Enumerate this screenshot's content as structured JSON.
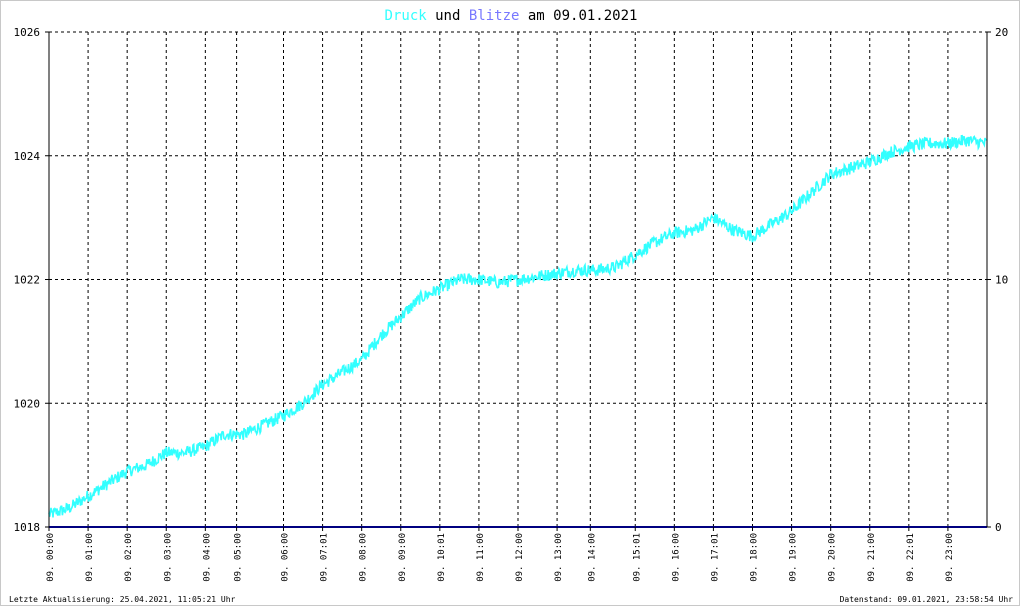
{
  "title": {
    "part1": "Druck",
    "part2": " und ",
    "part3": "Blitze",
    "part4": " am 09.01.2021",
    "colors": {
      "druck": "#33ffff",
      "blitze": "#7777ff",
      "text": "#000000"
    }
  },
  "footer": {
    "left": "Letzte Aktualisierung: 25.04.2021, 11:05:21 Uhr",
    "right": "Datenstand: 09.01.2021, 23:58:54 Uhr"
  },
  "chart_data": {
    "type": "line",
    "title": "Druck und Blitze am 09.01.2021",
    "y_left": {
      "range": [
        1018,
        1026
      ],
      "ticks": [
        "1018",
        "1020",
        "1022",
        "1024",
        "1026"
      ]
    },
    "y_right": {
      "range": [
        0,
        20
      ],
      "ticks": [
        "0",
        "10",
        "20"
      ]
    },
    "x": {
      "range_hours": [
        0,
        24
      ],
      "tick_labels": [
        "09. 00:00",
        "09. 01:00",
        "09. 02:00",
        "09. 03:00",
        "09. 04:00",
        "09. 05:00",
        "09. 06:00",
        "09. 07:01",
        "09. 08:00",
        "09. 09:00",
        "09. 10:01",
        "09. 11:00",
        "09. 12:00",
        "09. 13:00",
        "09. 14:00",
        "09. 15:01",
        "09. 16:00",
        "09. 17:01",
        "09. 18:00",
        "09. 19:00",
        "09. 20:00",
        "09. 21:00",
        "09. 22:01",
        "09. 23:00"
      ],
      "tick_hours": [
        0.0,
        1.0,
        2.0,
        3.0,
        4.0,
        4.8,
        6.0,
        7.0,
        8.0,
        9.0,
        10.0,
        11.0,
        12.0,
        13.0,
        13.85,
        15.0,
        16.0,
        17.0,
        18.0,
        19.0,
        20.0,
        21.0,
        22.0,
        23.0
      ]
    },
    "grid": true,
    "series": [
      {
        "name": "Druck",
        "color": "#33ffff",
        "axis": "left",
        "x_hours": [
          0,
          0.5,
          1,
          1.5,
          2,
          2.5,
          3,
          3.5,
          4,
          4.5,
          5,
          5.5,
          6,
          6.5,
          7,
          7.5,
          8,
          8.5,
          9,
          9.5,
          10,
          10.5,
          11,
          11.5,
          12,
          12.5,
          13,
          13.5,
          14,
          14.5,
          15,
          15.5,
          16,
          16.5,
          17,
          17.5,
          18,
          18.5,
          19,
          19.5,
          20,
          20.5,
          21,
          21.5,
          22,
          22.5,
          23,
          23.5,
          24
        ],
        "values": [
          1018.2,
          1018.3,
          1018.5,
          1018.7,
          1018.9,
          1019.0,
          1019.2,
          1019.2,
          1019.3,
          1019.5,
          1019.5,
          1019.65,
          1019.8,
          1020.0,
          1020.3,
          1020.5,
          1020.7,
          1021.1,
          1021.4,
          1021.7,
          1021.85,
          1022.0,
          1022.0,
          1021.95,
          1022.0,
          1022.05,
          1022.1,
          1022.15,
          1022.15,
          1022.2,
          1022.4,
          1022.6,
          1022.75,
          1022.8,
          1023.0,
          1022.8,
          1022.7,
          1022.9,
          1023.1,
          1023.4,
          1023.7,
          1023.8,
          1023.9,
          1024.05,
          1024.15,
          1024.2,
          1024.2,
          1024.25,
          1024.2
        ],
        "noise": 0.1
      },
      {
        "name": "Blitze",
        "color": "#000080",
        "axis": "right",
        "x_hours": [
          0,
          24
        ],
        "values": [
          0,
          0
        ]
      }
    ]
  }
}
